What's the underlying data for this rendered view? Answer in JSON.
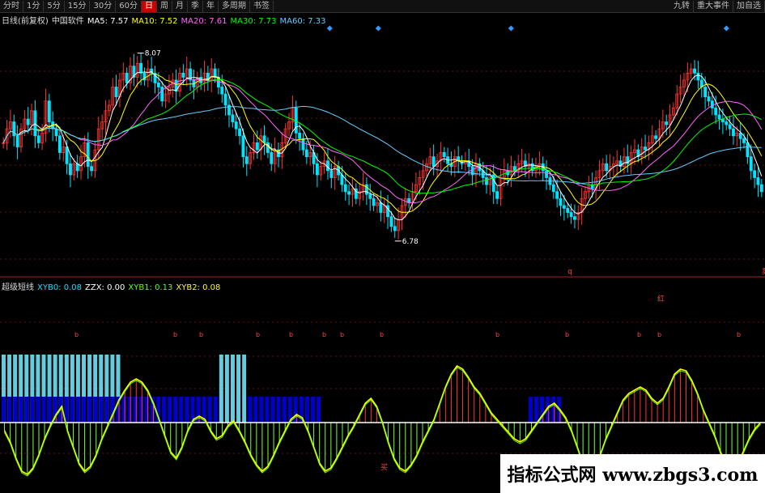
{
  "toolbar": {
    "left": [
      "分时",
      "1分",
      "5分",
      "15分",
      "30分",
      "60分",
      "日",
      "周",
      "月",
      "季",
      "年",
      "多周期",
      "书签"
    ],
    "active_index": 6,
    "right": [
      "九转",
      "重大事件",
      "加自选"
    ]
  },
  "main_legend": {
    "title": "日线(前复权)",
    "subtitle": "中国软件",
    "items": [
      {
        "label": "MA5",
        "value": "7.57",
        "color": "#ffffff"
      },
      {
        "label": "MA10",
        "value": "7.52",
        "color": "#ffff00"
      },
      {
        "label": "MA20",
        "value": "7.61",
        "color": "#ff66ff"
      },
      {
        "label": "MA30",
        "value": "7.73",
        "color": "#00ff00"
      },
      {
        "label": "MA60",
        "value": "7.33",
        "color": "#66ccff"
      }
    ]
  },
  "indicator_legend": {
    "title": "超级短线",
    "items": [
      {
        "label": "XYB0",
        "value": "0.08",
        "color": "#00e5ff"
      },
      {
        "label": "ZZX",
        "value": "0.00",
        "color": "#ffffff"
      },
      {
        "label": "XYB1",
        "value": "0.13",
        "color": "#66ff00"
      },
      {
        "label": "XYB2",
        "value": "0.08",
        "color": "#ffff00"
      }
    ]
  },
  "chart_data": [
    {
      "type": "candlestick",
      "panel": "price",
      "ylim": [
        6.5,
        8.3
      ],
      "annotations": [
        {
          "label": "8.07",
          "index": 38,
          "value": 8.07
        },
        {
          "label": "6.78",
          "index": 111,
          "value": 6.78
        },
        {
          "label": "q",
          "index": 160
        },
        {
          "label": "卖",
          "index": 215
        }
      ],
      "close": [
        7.45,
        7.55,
        7.6,
        7.5,
        7.42,
        7.55,
        7.62,
        7.58,
        7.68,
        7.5,
        7.45,
        7.52,
        7.75,
        7.6,
        7.55,
        7.5,
        7.38,
        7.42,
        7.3,
        7.22,
        7.3,
        7.25,
        7.35,
        7.45,
        7.28,
        7.25,
        7.4,
        7.55,
        7.6,
        7.68,
        7.72,
        7.85,
        7.78,
        7.9,
        7.95,
        7.88,
        8.0,
        7.92,
        8.02,
        7.95,
        7.9,
        7.98,
        7.95,
        7.88,
        7.85,
        7.75,
        7.8,
        7.85,
        7.9,
        7.82,
        7.95,
        7.92,
        7.98,
        7.9,
        7.85,
        7.92,
        7.88,
        7.95,
        7.9,
        7.98,
        7.92,
        7.85,
        7.8,
        7.72,
        7.65,
        7.6,
        7.55,
        7.5,
        7.35,
        7.3,
        7.38,
        7.45,
        7.4,
        7.5,
        7.45,
        7.38,
        7.3,
        7.4,
        7.35,
        7.45,
        7.55,
        7.6,
        7.7,
        7.52,
        7.48,
        7.4,
        7.35,
        7.38,
        7.3,
        7.22,
        7.28,
        7.32,
        7.25,
        7.2,
        7.28,
        7.22,
        7.15,
        7.1,
        7.08,
        7.12,
        7.05,
        7.1,
        7.15,
        7.08,
        7.05,
        7.0,
        7.02,
        6.95,
        7.0,
        6.92,
        6.85,
        6.82,
        6.9,
        7.0,
        7.05,
        7.02,
        7.1,
        7.15,
        7.2,
        7.25,
        7.3,
        7.35,
        7.28,
        7.32,
        7.38,
        7.35,
        7.3,
        7.28,
        7.35,
        7.32,
        7.3,
        7.32,
        7.28,
        7.22,
        7.3,
        7.25,
        7.2,
        7.15,
        7.22,
        7.1,
        7.05,
        7.2,
        7.25,
        7.22,
        7.28,
        7.25,
        7.3,
        7.32,
        7.28,
        7.3,
        7.25,
        7.28,
        7.3,
        7.25,
        7.2,
        7.15,
        7.1,
        7.05,
        7.0,
        6.98,
        6.95,
        6.92,
        6.9,
        6.95,
        7.05,
        7.1,
        7.15,
        7.12,
        7.2,
        7.25,
        7.3,
        7.25,
        7.28,
        7.3,
        7.32,
        7.28,
        7.35,
        7.3,
        7.38,
        7.4,
        7.35,
        7.42,
        7.4,
        7.45,
        7.5,
        7.48,
        7.55,
        7.6,
        7.58,
        7.65,
        7.7,
        7.8,
        7.85,
        7.9,
        7.95,
        7.98,
        7.95,
        7.9,
        7.85,
        7.78,
        7.75,
        7.7,
        7.65,
        7.62,
        7.6,
        7.58,
        7.55,
        7.5,
        7.52,
        7.48,
        7.45,
        7.35,
        7.25,
        7.2,
        7.15,
        7.1
      ],
      "ma_colors": {
        "MA5": "#ffffff",
        "MA10": "#ffff00",
        "MA20": "#ff66ff",
        "MA30": "#00ff00",
        "MA60": "#66ccff"
      }
    },
    {
      "type": "bar",
      "panel": "indicator",
      "ylim": [
        -0.45,
        0.45
      ],
      "values": [
        -0.05,
        -0.12,
        -0.22,
        -0.3,
        -0.32,
        -0.28,
        -0.2,
        -0.1,
        -0.02,
        0.05,
        0.1,
        -0.05,
        -0.15,
        -0.25,
        -0.3,
        -0.27,
        -0.2,
        -0.1,
        -0.02,
        0.06,
        0.14,
        0.2,
        0.25,
        0.27,
        0.25,
        0.2,
        0.12,
        0.02,
        -0.08,
        -0.18,
        -0.22,
        -0.15,
        -0.05,
        0.02,
        0.04,
        0.02,
        -0.05,
        -0.1,
        -0.08,
        -0.02,
        0.01,
        -0.05,
        -0.12,
        -0.2,
        -0.26,
        -0.3,
        -0.27,
        -0.2,
        -0.12,
        -0.05,
        0.02,
        0.05,
        0.03,
        -0.05,
        -0.15,
        -0.25,
        -0.3,
        -0.28,
        -0.22,
        -0.15,
        -0.08,
        -0.02,
        0.05,
        0.12,
        0.15,
        0.1,
        0.0,
        -0.12,
        -0.22,
        -0.28,
        -0.3,
        -0.26,
        -0.2,
        -0.12,
        -0.05,
        0.02,
        0.12,
        0.22,
        0.3,
        0.35,
        0.33,
        0.28,
        0.22,
        0.18,
        0.12,
        0.06,
        0.02,
        -0.02,
        -0.06,
        -0.1,
        -0.12,
        -0.1,
        -0.05,
        0.0,
        0.05,
        0.1,
        0.12,
        0.08,
        0.03,
        -0.05,
        -0.15,
        -0.25,
        -0.3,
        -0.28,
        -0.2,
        -0.1,
        -0.02,
        0.06,
        0.14,
        0.18,
        0.2,
        0.22,
        0.2,
        0.15,
        0.12,
        0.15,
        0.22,
        0.3,
        0.33,
        0.32,
        0.26,
        0.18,
        0.08,
        0.0,
        -0.08,
        -0.18,
        -0.25,
        -0.28,
        -0.25,
        -0.18,
        -0.1,
        -0.04,
        0.0
      ],
      "upper_blocks": [
        {
          "from": 0,
          "to": 20,
          "color": "#66ccdd",
          "level": 0.12
        },
        {
          "from": 0,
          "to": 55,
          "color": "#0000cc",
          "level": 0.06
        },
        {
          "from": 38,
          "to": 42,
          "color": "#66ccdd",
          "level": 0.12
        },
        {
          "from": 92,
          "to": 97,
          "color": "#0000cc",
          "level": 0.06
        }
      ],
      "markers": {
        "top": "红",
        "bottom": "买",
        "small": "b"
      }
    }
  ],
  "watermark": "指标公式网 www.zbgs3.com"
}
